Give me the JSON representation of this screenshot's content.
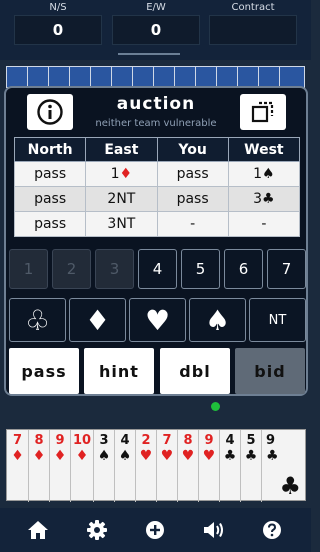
{
  "scores": [
    {
      "label": "N/S",
      "value": "0"
    },
    {
      "label": "E/W",
      "value": "0"
    },
    {
      "label": "Contract",
      "value": ""
    }
  ],
  "auction": {
    "title": "auction",
    "vulnerability": "neither team vulnerable",
    "headers": [
      "North",
      "East",
      "You",
      "West"
    ],
    "rows": [
      [
        {
          "t": "pass"
        },
        {
          "t": "1",
          "s": "♦",
          "red": true
        },
        {
          "t": "pass"
        },
        {
          "t": "1",
          "s": "♠"
        }
      ],
      [
        {
          "t": "pass"
        },
        {
          "t": "2NT"
        },
        {
          "t": "pass"
        },
        {
          "t": "3",
          "s": "♣"
        }
      ],
      [
        {
          "t": "pass"
        },
        {
          "t": "3NT"
        },
        {
          "t": "-"
        },
        {
          "t": "-"
        }
      ]
    ]
  },
  "levels": [
    {
      "label": "1",
      "enabled": false
    },
    {
      "label": "2",
      "enabled": false
    },
    {
      "label": "3",
      "enabled": false
    },
    {
      "label": "4",
      "enabled": true
    },
    {
      "label": "5",
      "enabled": true
    },
    {
      "label": "6",
      "enabled": true
    },
    {
      "label": "7",
      "enabled": true
    }
  ],
  "strains": [
    "♧",
    "♦",
    "♥",
    "♠",
    "NT"
  ],
  "actions": [
    {
      "label": "pass",
      "enabled": true
    },
    {
      "label": "hint",
      "enabled": true
    },
    {
      "label": "dbl",
      "enabled": true
    },
    {
      "label": "bid",
      "enabled": false
    }
  ],
  "hand": [
    {
      "rank": "7",
      "suit": "♦",
      "red": true
    },
    {
      "rank": "8",
      "suit": "♦",
      "red": true
    },
    {
      "rank": "9",
      "suit": "♦",
      "red": true
    },
    {
      "rank": "10",
      "suit": "♦",
      "red": true
    },
    {
      "rank": "3",
      "suit": "♠",
      "red": false
    },
    {
      "rank": "4",
      "suit": "♠",
      "red": false
    },
    {
      "rank": "2",
      "suit": "♥",
      "red": true
    },
    {
      "rank": "7",
      "suit": "♥",
      "red": true
    },
    {
      "rank": "8",
      "suit": "♥",
      "red": true
    },
    {
      "rank": "9",
      "suit": "♥",
      "red": true
    },
    {
      "rank": "4",
      "suit": "♣",
      "red": false
    },
    {
      "rank": "5",
      "suit": "♣",
      "red": false
    },
    {
      "rank": "9",
      "suit": "♣",
      "red": false
    }
  ],
  "hand_last_suit": "♣",
  "toolbar": [
    "home-icon",
    "settings-icon",
    "add-icon",
    "sound-icon",
    "help-icon"
  ],
  "colors": {
    "red_suit": "#e02222",
    "panel": "#0a1321",
    "background": "#1b2a3d",
    "status_dot": "#1fbf3b"
  }
}
